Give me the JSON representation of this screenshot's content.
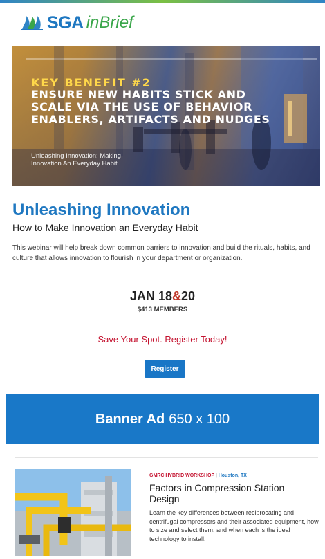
{
  "brand": {
    "logo_primary": "SGA",
    "logo_secondary": "inBrief",
    "logo_icon": "sga-flame-logo-icon",
    "primary_color": "#1f78c1",
    "secondary_color": "#3aa64a"
  },
  "hero": {
    "kicker": "KEY BENEFIT #2",
    "headline": "ENSURE NEW HABITS STICK AND SCALE VIA THE USE OF BEHAVIOR ENABLERS, ARTIFACTS AND NUDGES",
    "caption": "Unleashing Innovation: Making Innovation An Everyday Habit"
  },
  "webinar": {
    "title": "Unleashing Innovation",
    "subtitle": "How to Make Innovation an Everyday Habit",
    "description": "This webinar will help break down common barriers to innovation and build the rituals, habits, and culture that allows innovation to flourish in your department or organization.",
    "date_part1": "JAN 18",
    "date_amp": "&",
    "date_part2": "20",
    "price": "$413 MEMBERS",
    "cta": "Save Your Spot. Register Today!",
    "register_label": "Register",
    "accent_red": "#c4122f"
  },
  "banner": {
    "bold": "Banner Ad",
    "size": "650 x 100",
    "color": "#1978c8"
  },
  "event": {
    "tag": "GMRC HYBRID WORKSHOP",
    "separator": "|",
    "location": "Houston, TX",
    "title": "Factors in Compression Station Design",
    "description": "Learn the key differences between reciprocating and centrifugal compressors and their associated equipment, how to size and select them, and when each is the ideal technology to install."
  }
}
